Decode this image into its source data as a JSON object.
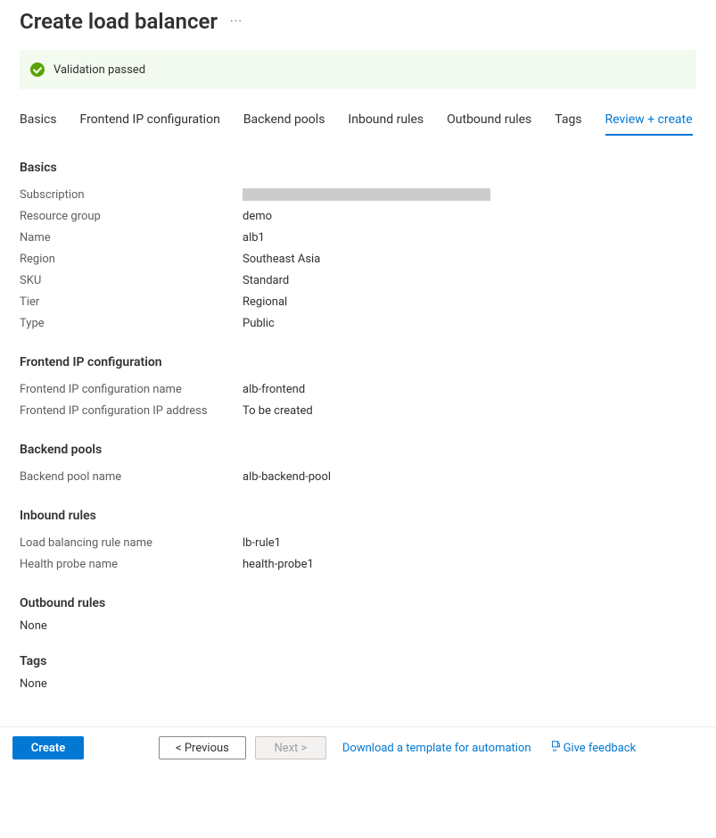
{
  "header": {
    "title": "Create load balancer"
  },
  "validation": {
    "message": "Validation passed"
  },
  "tabs": [
    {
      "label": "Basics"
    },
    {
      "label": "Frontend IP configuration"
    },
    {
      "label": "Backend pools"
    },
    {
      "label": "Inbound rules"
    },
    {
      "label": "Outbound rules"
    },
    {
      "label": "Tags"
    },
    {
      "label": "Review + create"
    }
  ],
  "sections": {
    "basics": {
      "title": "Basics",
      "rows": {
        "subscription_label": "Subscription",
        "resource_group_label": "Resource group",
        "resource_group_value": "demo",
        "name_label": "Name",
        "name_value": "alb1",
        "region_label": "Region",
        "region_value": "Southeast Asia",
        "sku_label": "SKU",
        "sku_value": "Standard",
        "tier_label": "Tier",
        "tier_value": "Regional",
        "type_label": "Type",
        "type_value": "Public"
      }
    },
    "frontend": {
      "title": "Frontend IP configuration",
      "rows": {
        "name_label": "Frontend IP configuration name",
        "name_value": "alb-frontend",
        "ip_label": "Frontend IP configuration IP address",
        "ip_value": "To be created"
      }
    },
    "backend": {
      "title": "Backend pools",
      "rows": {
        "name_label": "Backend pool name",
        "name_value": "alb-backend-pool"
      }
    },
    "inbound": {
      "title": "Inbound rules",
      "rows": {
        "rule_label": "Load balancing rule name",
        "rule_value": "lb-rule1",
        "probe_label": "Health probe name",
        "probe_value": "health-probe1"
      }
    },
    "outbound": {
      "title": "Outbound rules",
      "none": "None"
    },
    "tags": {
      "title": "Tags",
      "none": "None"
    }
  },
  "footer": {
    "create": "Create",
    "previous": "< Previous",
    "next": "Next >",
    "download": "Download a template for automation",
    "feedback": "Give feedback"
  }
}
